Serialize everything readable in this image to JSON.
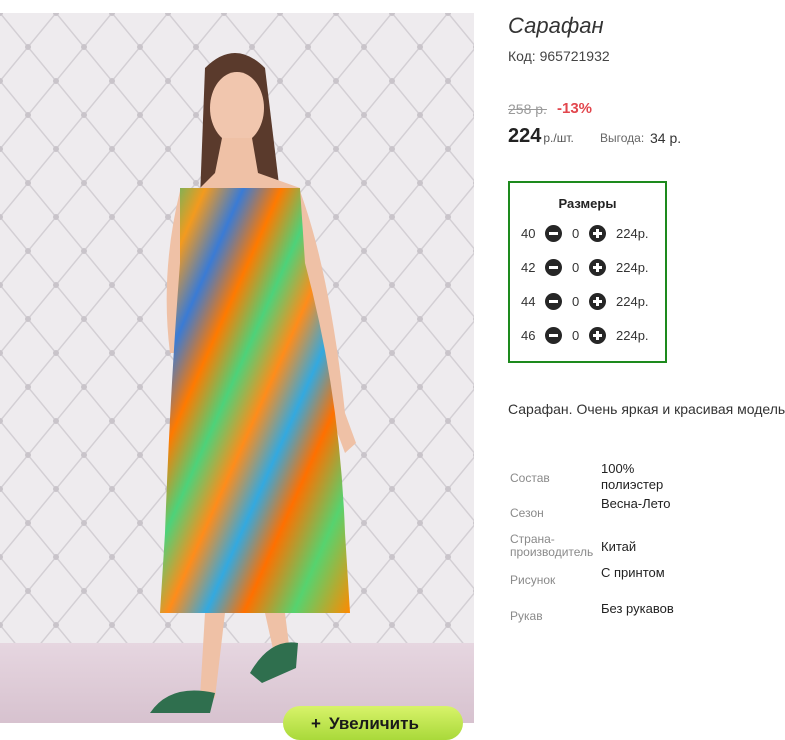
{
  "product": {
    "title": "Сарафан",
    "code": "Код: 965721932",
    "old_price": "258 р.",
    "discount": "-13%",
    "price": "224",
    "price_unit": "р./шт.",
    "benefit_label": "Выгода:",
    "benefit_value": "34 р.",
    "description": "Сарафан. Очень яркая и красивая модель"
  },
  "photo": {
    "zoom_label": "Увеличить",
    "zoom_icon": "plus-icon"
  },
  "sizes": {
    "title": "Размеры",
    "rows": [
      {
        "size": "40",
        "qty": "0",
        "price": "224р."
      },
      {
        "size": "42",
        "qty": "0",
        "price": "224р."
      },
      {
        "size": "44",
        "qty": "0",
        "price": "224р."
      },
      {
        "size": "46",
        "qty": "0",
        "price": "224р."
      }
    ]
  },
  "properties": [
    {
      "key": "Состав",
      "value": "100% полиэстер"
    },
    {
      "key": "Сезон",
      "value": "Весна-Лето"
    },
    {
      "key": "Страна-производитель",
      "value": "Китай"
    },
    {
      "key": "Рисунок",
      "value": "С принтом"
    },
    {
      "key": "Рукав",
      "value": "Без рукавов"
    }
  ],
  "colors": {
    "accent_green": "#1d8a1d",
    "discount_red": "#e2464d"
  }
}
